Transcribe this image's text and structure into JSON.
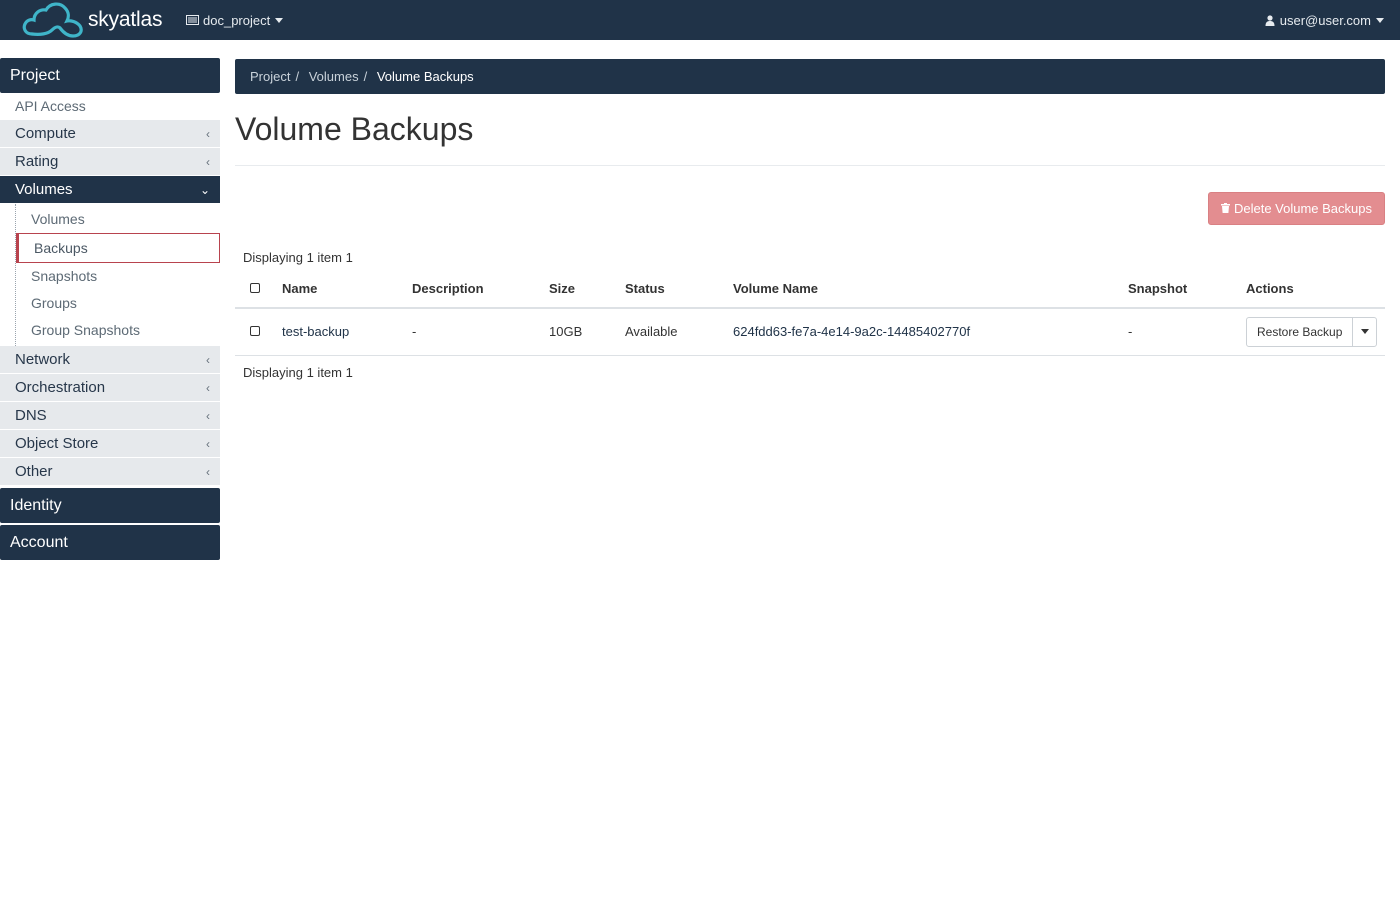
{
  "navbar": {
    "brand": "skyatlas",
    "project": "doc_project",
    "user": "user@user.com"
  },
  "sidebar": {
    "project_header": "Project",
    "api_access": "API Access",
    "groups": {
      "compute": "Compute",
      "rating": "Rating",
      "volumes": "Volumes",
      "network": "Network",
      "orchestration": "Orchestration",
      "dns": "DNS",
      "object_store": "Object Store",
      "other": "Other"
    },
    "volumes_items": [
      "Volumes",
      "Backups",
      "Snapshots",
      "Groups",
      "Group Snapshots"
    ],
    "identity_header": "Identity",
    "account_header": "Account"
  },
  "breadcrumb": [
    "Project",
    "Volumes",
    "Volume Backups"
  ],
  "page": {
    "title": "Volume Backups",
    "delete_button": "Delete Volume Backups",
    "count_text": "Displaying 1 item 1"
  },
  "table": {
    "columns": [
      "Name",
      "Description",
      "Size",
      "Status",
      "Volume Name",
      "Snapshot",
      "Actions"
    ],
    "rows": [
      {
        "name": "test-backup",
        "description": "-",
        "size": "10GB",
        "status": "Available",
        "volume_name": "624fdd63-fe7a-4e14-9a2c-14485402770f",
        "snapshot": "-",
        "action": "Restore Backup"
      }
    ]
  },
  "colors": {
    "navbar": "#203348",
    "danger_button": "#e38d90",
    "active_item_border": "#b8434e"
  }
}
